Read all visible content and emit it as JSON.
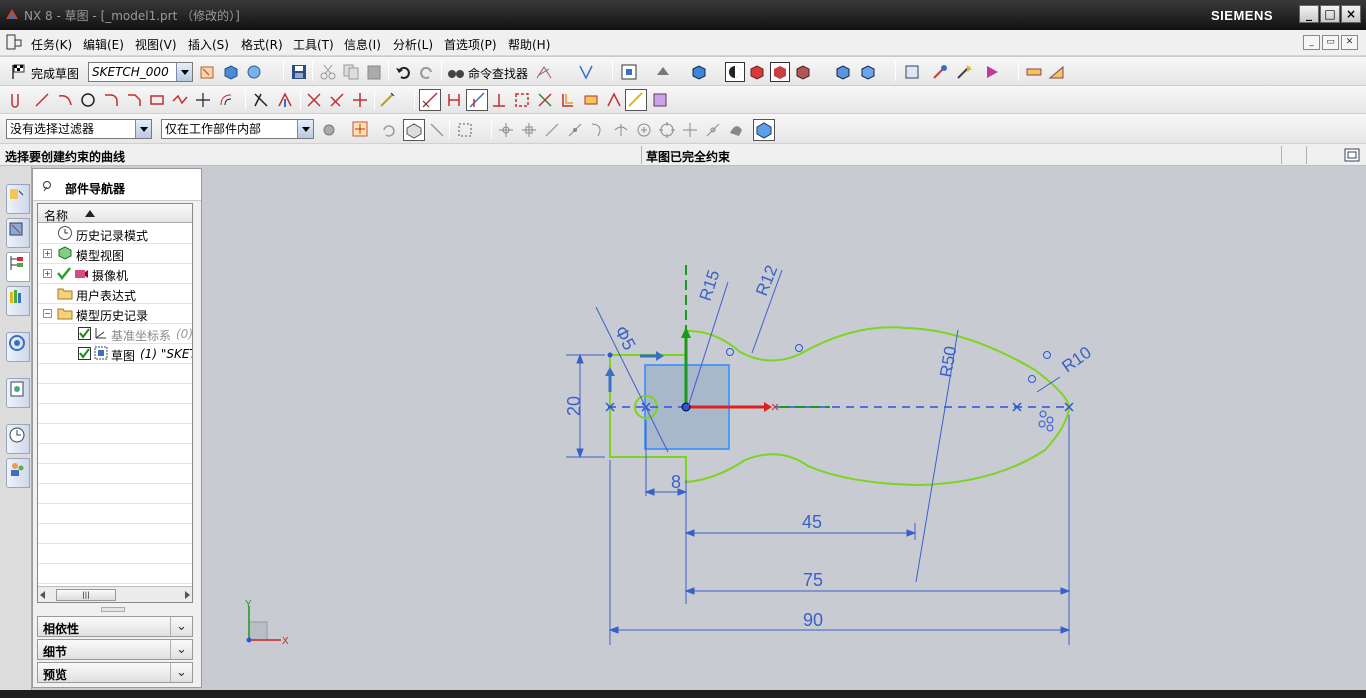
{
  "window": {
    "title": "NX 8 - 草图 - [_model1.prt （修改的）]",
    "brand": "SIEMENS",
    "buttons": [
      "_",
      "□",
      "×"
    ]
  },
  "menu": {
    "items": [
      "任务(K)",
      "编辑(E)",
      "视图(V)",
      "插入(S)",
      "格式(R)",
      "工具(T)",
      "信息(I)",
      "分析(L)",
      "首选项(P)",
      "帮助(H)"
    ]
  },
  "toolbar": {
    "finish_sketch_label": "完成草图",
    "sketch_name": "SKETCH_000",
    "command_finder_label": "命令查找器",
    "selection_filter": "没有选择过滤器",
    "selection_scope": "仅在工作部件内部"
  },
  "status": {
    "prompt": "选择要创建约束的曲线",
    "state": "草图已完全约束"
  },
  "navigator": {
    "title": "部件导航器",
    "column_header": "名称",
    "items": [
      {
        "label": "历史记录模式"
      },
      {
        "label": "模型视图"
      },
      {
        "label": "摄像机"
      },
      {
        "label": "用户表达式"
      },
      {
        "label": "模型历史记录"
      },
      {
        "label": "基准坐标系",
        "suffix": "(0)"
      },
      {
        "label": "草图",
        "suffix": "(1) \"SKET"
      }
    ],
    "panels": [
      "相依性",
      "细节",
      "预览"
    ]
  },
  "sketch": {
    "dims": {
      "phi5": "Φ5",
      "r15": "R15",
      "r12": "R12",
      "r50": "R50",
      "r10": "R10",
      "d20": "20",
      "d8": "8",
      "d45": "45",
      "d75": "75",
      "d90": "90"
    },
    "triad": {
      "x": "X",
      "y": "Y"
    }
  },
  "colors": {
    "sketch_curve": "#7ed321",
    "dimension": "#3a5fc8",
    "datum_x": "#e02020",
    "datum_y": "#1a9a1a",
    "canvas": "#c8ccd2"
  }
}
